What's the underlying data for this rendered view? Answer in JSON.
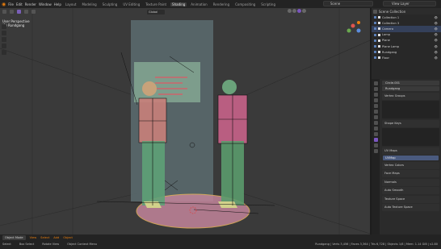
{
  "topbar": {
    "menus": [
      "File",
      "Edit",
      "Render",
      "Window",
      "Help"
    ],
    "workspaces": [
      "Layout",
      "Modeling",
      "Sculpting",
      "UV Editing",
      "Texture Paint",
      "Shading",
      "Animation",
      "Rendering",
      "Compositing",
      "Scripting"
    ],
    "active_workspace": "Layout",
    "scene": "Scene",
    "view_layer": "View Layer"
  },
  "viewport": {
    "view_label": "User Perspective",
    "object_label": "(1) Rundgang",
    "transform": "Global",
    "colors": {
      "pinkish": "#ca7f79",
      "green": "#4f9b6a",
      "floor": "#c6889f",
      "accent": "#7b56c0"
    }
  },
  "outliner": {
    "title": "Scene Collection",
    "rows": [
      {
        "label": "Collection 1"
      },
      {
        "label": "Collection 3"
      },
      {
        "label": "Camera"
      },
      {
        "label": "Lamp"
      },
      {
        "label": "Plane"
      },
      {
        "label": "Plane Lamp"
      },
      {
        "label": "Rundgang"
      },
      {
        "label": "Floor"
      }
    ]
  },
  "properties": {
    "object_name": "Circle.001",
    "search": "Rundgang",
    "panels": [
      "Vertex Groups",
      "Shape Keys",
      "UV Maps",
      "Vertex Colors",
      "Face Maps",
      "Normals",
      "Auto Smooth",
      "Texture Space",
      "Auto Texture Space"
    ],
    "uv_item": "UVMap"
  },
  "statusbar": {
    "mode": "Object Mode",
    "menu": [
      "View",
      "Select",
      "Add",
      "Object"
    ],
    "hints": [
      "Select",
      "Box Select",
      "Rotate View",
      "Object Context Menu"
    ],
    "stats": "Rundgang | Verts 3,456 | Faces 3,364 | Tris 6,728 | Objects 1/8 | Mem: 1.14 GiB | v2.80"
  }
}
